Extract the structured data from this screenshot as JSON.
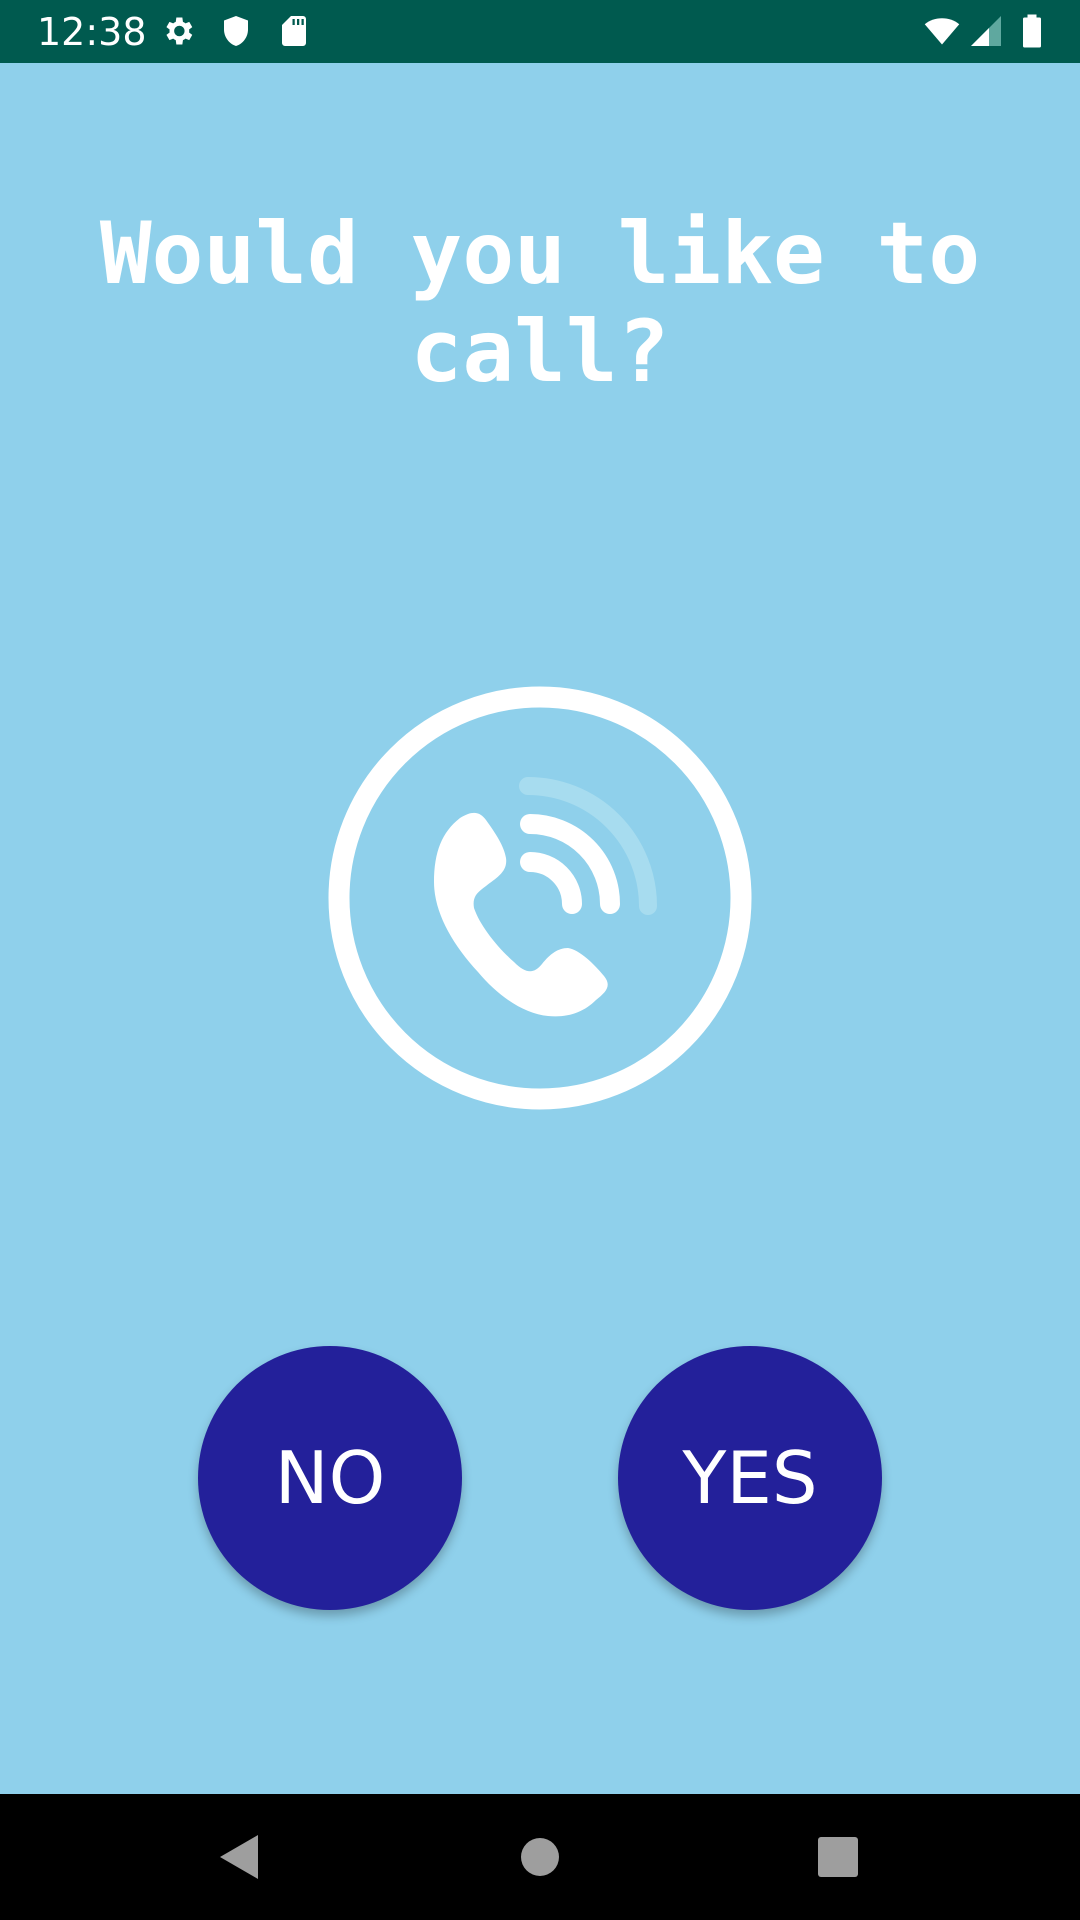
{
  "status_bar": {
    "time": "12:38",
    "left_icons": [
      "gear-icon",
      "shield-icon",
      "sd-card-icon"
    ],
    "right_icons": [
      "wifi-icon",
      "cell-signal-icon",
      "battery-icon"
    ],
    "background": "#005a4f"
  },
  "main": {
    "question": "Would you like to call?",
    "icon": "phone-call-icon",
    "background": "#8fd0eb"
  },
  "buttons": {
    "no_label": "NO",
    "yes_label": "YES",
    "color": "#23209a"
  },
  "nav_bar": {
    "icons": [
      "back-icon",
      "home-icon",
      "recents-icon"
    ]
  }
}
